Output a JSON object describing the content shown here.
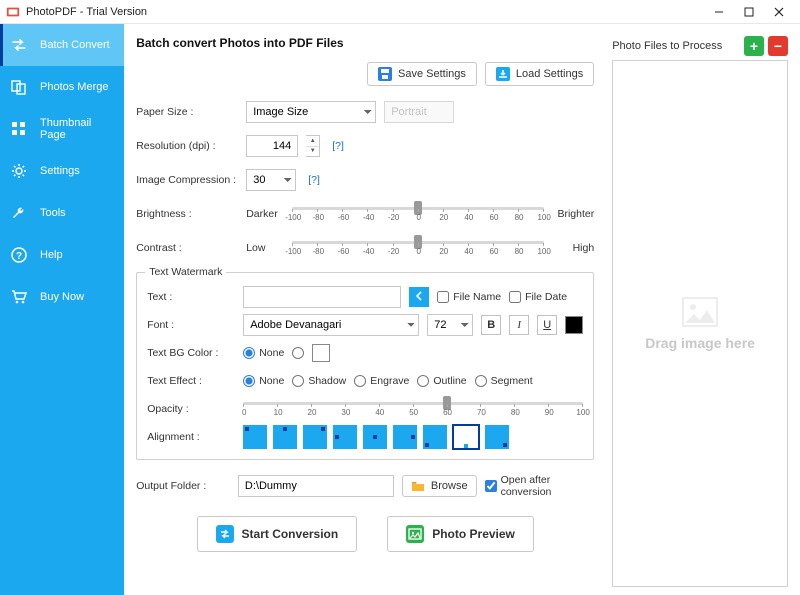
{
  "window": {
    "title": "PhotoPDF - Trial Version"
  },
  "sidebar": {
    "items": [
      {
        "label": "Batch Convert"
      },
      {
        "label": "Photos Merge"
      },
      {
        "label": "Thumbnail Page"
      },
      {
        "label": "Settings"
      },
      {
        "label": "Tools"
      },
      {
        "label": "Help"
      },
      {
        "label": "Buy Now"
      }
    ]
  },
  "main": {
    "heading": "Batch convert Photos into PDF Files",
    "save_btn": "Save Settings",
    "load_btn": "Load Settings",
    "paper_size_lbl": "Paper Size :",
    "paper_size_val": "Image Size",
    "orientation_val": "Portrait",
    "resolution_lbl": "Resolution (dpi) :",
    "resolution_val": "144",
    "help_q": "[?]",
    "compression_lbl": "Image Compression :",
    "compression_val": "30",
    "brightness_lbl": "Brightness :",
    "brightness_left": "Darker",
    "brightness_right": "Brighter",
    "contrast_lbl": "Contrast :",
    "contrast_left": "Low",
    "contrast_right": "High",
    "slider_ticks": [
      "-100",
      "-80",
      "-60",
      "-40",
      "-20",
      "0",
      "20",
      "40",
      "60",
      "80",
      "100"
    ],
    "watermark": {
      "title": "Text Watermark",
      "text_lbl": "Text :",
      "text_val": "",
      "filename_lbl": "File Name",
      "filedate_lbl": "File Date",
      "font_lbl": "Font :",
      "font_val": "Adobe Devanagari",
      "fontsize_val": "72",
      "bgcolor_lbl": "Text BG Color :",
      "none_lbl": "None",
      "effect_lbl": "Text Effect :",
      "effect_shadow": "Shadow",
      "effect_engrave": "Engrave",
      "effect_outline": "Outline",
      "effect_segment": "Segment",
      "opacity_lbl": "Opacity :",
      "opacity_ticks": [
        "0",
        "10",
        "20",
        "30",
        "40",
        "50",
        "60",
        "70",
        "80",
        "90",
        "100"
      ],
      "alignment_lbl": "Alignment :"
    },
    "output_lbl": "Output Folder :",
    "output_val": "D:\\Dummy",
    "browse_btn": "Browse",
    "open_after_lbl": "Open after conversion",
    "start_btn": "Start Conversion",
    "preview_btn": "Photo Preview"
  },
  "right": {
    "header": "Photo Files to Process",
    "drop_hint": "Drag image here"
  }
}
